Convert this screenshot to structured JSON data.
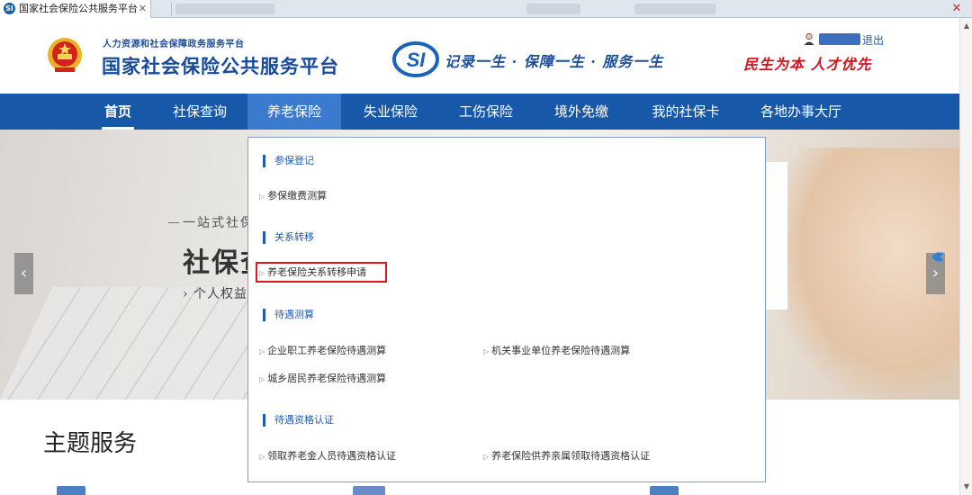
{
  "browser": {
    "tab_title": "国家社会保险公共服务平台",
    "tab_favicon": "SI",
    "tab_close": "✕",
    "window_close": "✕"
  },
  "header": {
    "org_sub": "人力资源和社会保障政务服务平台",
    "org_title": "国家社会保险公共服务平台",
    "slogan": "记录一生 · 保障一生 · 服务一生",
    "motto": "民生为本 人才优先",
    "logout": "退出"
  },
  "nav": {
    "items": [
      {
        "label": "首页"
      },
      {
        "label": "社保查询"
      },
      {
        "label": "养老保险"
      },
      {
        "label": "失业保险"
      },
      {
        "label": "工伤保险"
      },
      {
        "label": "境外免缴"
      },
      {
        "label": "我的社保卡"
      },
      {
        "label": "各地办事大厅"
      }
    ]
  },
  "banner": {
    "small": "一站式社保",
    "big": "社保查",
    "sub": "› 个人权益",
    "prev": "‹",
    "next": "›",
    "chevrons": "‹‹‹"
  },
  "dropdown": {
    "sections": [
      {
        "heading": "参保登记",
        "links": [
          "参保缴费测算"
        ]
      },
      {
        "heading": "关系转移",
        "links": [
          "养老保险关系转移申请"
        ]
      },
      {
        "heading": "待遇测算",
        "links": [
          "企业职工养老保险待遇测算",
          "机关事业单位养老保险待遇测算",
          "城乡居民养老保险待遇测算"
        ]
      },
      {
        "heading": "待遇资格认证",
        "links": [
          "领取养老金人员待遇资格认证",
          "养老保险供养亲属领取待遇资格认证"
        ]
      }
    ],
    "link_marker": "▷"
  },
  "main": {
    "section_title": "主题服务"
  },
  "colors": {
    "nav_bg": "#1759a8",
    "accent_blue": "#1f5cb0",
    "highlight_red": "#e0151d",
    "motto_red": "#d3141f"
  }
}
